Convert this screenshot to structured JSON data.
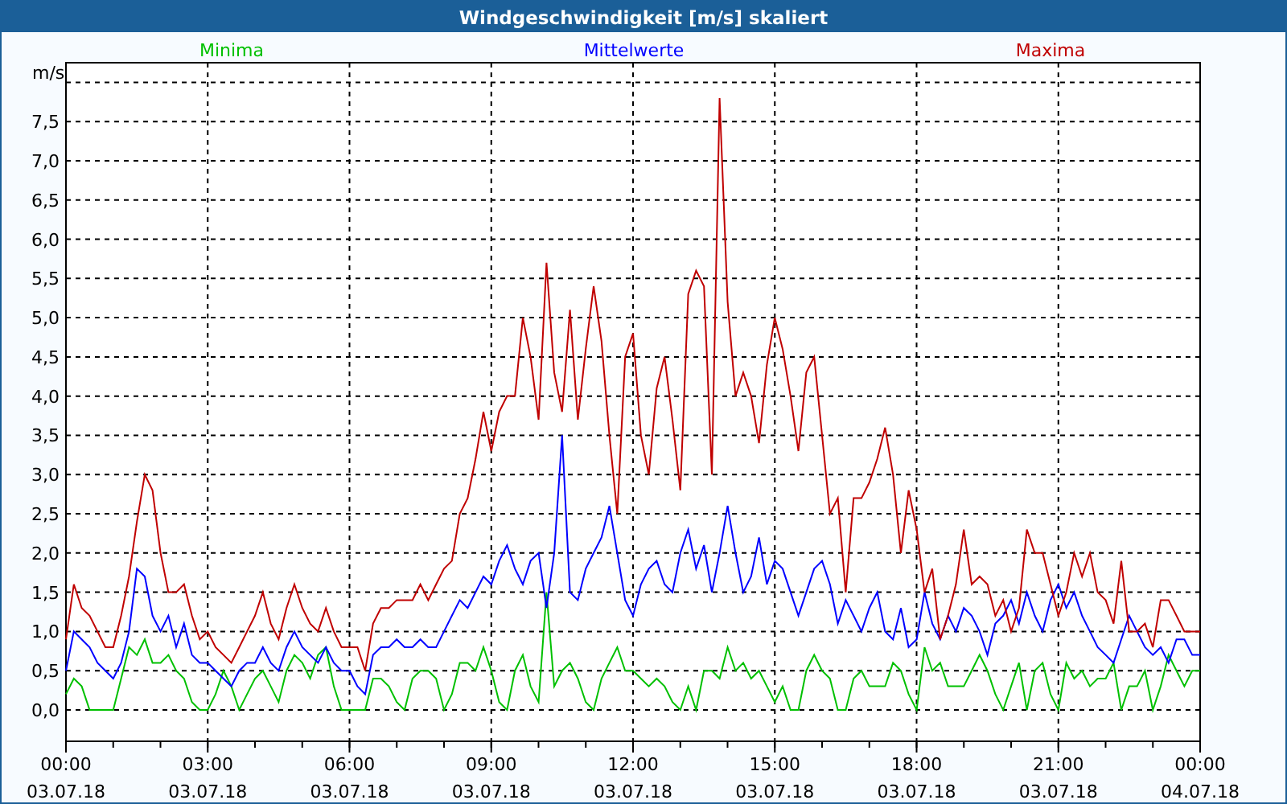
{
  "window": {
    "title": "Windgeschwindigkeit [m/s] skaliert"
  },
  "chart": {
    "x_tick_dates": [
      "03.07.18",
      "03.07.18",
      "03.07.18",
      "03.07.18",
      "03.07.18",
      "03.07.18",
      "03.07.18",
      "03.07.18",
      "04.07.18"
    ],
    "chart_data": {
      "type": "line",
      "ylabel": "m/s",
      "grid": true,
      "x": [
        0,
        0.167,
        0.333,
        0.5,
        0.667,
        0.833,
        1,
        1.167,
        1.333,
        1.5,
        1.667,
        1.833,
        2,
        2.167,
        2.333,
        2.5,
        2.667,
        2.833,
        3,
        3.167,
        3.333,
        3.5,
        3.667,
        3.833,
        4,
        4.167,
        4.333,
        4.5,
        4.667,
        4.833,
        5,
        5.167,
        5.333,
        5.5,
        5.667,
        5.833,
        6,
        6.167,
        6.333,
        6.5,
        6.667,
        6.833,
        7,
        7.167,
        7.333,
        7.5,
        7.667,
        7.833,
        8,
        8.167,
        8.333,
        8.5,
        8.667,
        8.833,
        9,
        9.167,
        9.333,
        9.5,
        9.667,
        9.833,
        10,
        10.167,
        10.333,
        10.5,
        10.667,
        10.833,
        11,
        11.167,
        11.333,
        11.5,
        11.667,
        11.833,
        12,
        12.167,
        12.333,
        12.5,
        12.667,
        12.833,
        13,
        13.167,
        13.333,
        13.5,
        13.667,
        13.833,
        14,
        14.167,
        14.333,
        14.5,
        14.667,
        14.833,
        15,
        15.167,
        15.333,
        15.5,
        15.667,
        15.833,
        16,
        16.167,
        16.333,
        16.5,
        16.667,
        16.833,
        17,
        17.167,
        17.333,
        17.5,
        17.667,
        17.833,
        18,
        18.167,
        18.333,
        18.5,
        18.667,
        18.833,
        19,
        19.167,
        19.333,
        19.5,
        19.667,
        19.833,
        20,
        20.167,
        20.333,
        20.5,
        20.667,
        20.833,
        21,
        21.167,
        21.333,
        21.5,
        21.667,
        21.833,
        22,
        22.167,
        22.333,
        22.5,
        22.667,
        22.833,
        23,
        23.167,
        23.333,
        23.5,
        23.667,
        23.833,
        24
      ],
      "xlim": [
        0,
        24
      ],
      "ylim": [
        -0.4,
        8.25
      ],
      "xticks": [
        {
          "value": 0,
          "label": "00:00"
        },
        {
          "value": 3,
          "label": "03:00"
        },
        {
          "value": 6,
          "label": "06:00"
        },
        {
          "value": 9,
          "label": "09:00"
        },
        {
          "value": 12,
          "label": "12:00"
        },
        {
          "value": 15,
          "label": "15:00"
        },
        {
          "value": 18,
          "label": "18:00"
        },
        {
          "value": 21,
          "label": "21:00"
        },
        {
          "value": 24,
          "label": "00:00"
        }
      ],
      "yticks": [
        {
          "value": 0,
          "label": "0,0"
        },
        {
          "value": 0.5,
          "label": "0,5"
        },
        {
          "value": 1,
          "label": "1,0"
        },
        {
          "value": 1.5,
          "label": "1,5"
        },
        {
          "value": 2,
          "label": "2,0"
        },
        {
          "value": 2.5,
          "label": "2,5"
        },
        {
          "value": 3,
          "label": "3,0"
        },
        {
          "value": 3.5,
          "label": "3,5"
        },
        {
          "value": 4,
          "label": "4,0"
        },
        {
          "value": 4.5,
          "label": "4,5"
        },
        {
          "value": 5,
          "label": "5,0"
        },
        {
          "value": 5.5,
          "label": "5,5"
        },
        {
          "value": 6,
          "label": "6,0"
        },
        {
          "value": 6.5,
          "label": "6,5"
        },
        {
          "value": 7,
          "label": "7,0"
        },
        {
          "value": 7.5,
          "label": "7,5"
        }
      ],
      "series": [
        {
          "name": "Minima",
          "color": "#00c000",
          "values": [
            0.2,
            0.4,
            0.3,
            0.0,
            0.0,
            0.0,
            0.0,
            0.4,
            0.8,
            0.7,
            0.9,
            0.6,
            0.6,
            0.7,
            0.5,
            0.4,
            0.1,
            0.0,
            0.0,
            0.2,
            0.5,
            0.3,
            0.0,
            0.2,
            0.4,
            0.5,
            0.3,
            0.1,
            0.5,
            0.7,
            0.6,
            0.4,
            0.7,
            0.8,
            0.3,
            0.0,
            0.0,
            0.0,
            0.0,
            0.4,
            0.4,
            0.3,
            0.1,
            0.0,
            0.4,
            0.5,
            0.5,
            0.4,
            0.0,
            0.2,
            0.6,
            0.6,
            0.5,
            0.8,
            0.5,
            0.1,
            0.0,
            0.5,
            0.7,
            0.3,
            0.1,
            1.5,
            0.3,
            0.5,
            0.6,
            0.4,
            0.1,
            0.0,
            0.4,
            0.6,
            0.8,
            0.5,
            0.5,
            0.4,
            0.3,
            0.4,
            0.3,
            0.1,
            0.0,
            0.3,
            0.0,
            0.5,
            0.5,
            0.4,
            0.8,
            0.5,
            0.6,
            0.4,
            0.5,
            0.3,
            0.1,
            0.3,
            0.0,
            0.0,
            0.5,
            0.7,
            0.5,
            0.4,
            0.0,
            0.0,
            0.4,
            0.5,
            0.3,
            0.3,
            0.3,
            0.6,
            0.5,
            0.2,
            0.0,
            0.8,
            0.5,
            0.6,
            0.3,
            0.3,
            0.3,
            0.5,
            0.7,
            0.5,
            0.2,
            0.0,
            0.3,
            0.6,
            0.0,
            0.5,
            0.6,
            0.2,
            0.0,
            0.6,
            0.4,
            0.5,
            0.3,
            0.4,
            0.4,
            0.6,
            0.0,
            0.3,
            0.3,
            0.5,
            0.0,
            0.3,
            0.7,
            0.5,
            0.3,
            0.5,
            0.5
          ]
        },
        {
          "name": "Mittelwerte",
          "color": "#0000ff",
          "values": [
            0.5,
            1.0,
            0.9,
            0.8,
            0.6,
            0.5,
            0.4,
            0.6,
            1.0,
            1.8,
            1.7,
            1.2,
            1.0,
            1.2,
            0.8,
            1.1,
            0.7,
            0.6,
            0.6,
            0.5,
            0.4,
            0.3,
            0.5,
            0.6,
            0.6,
            0.8,
            0.6,
            0.5,
            0.8,
            1.0,
            0.8,
            0.7,
            0.6,
            0.8,
            0.6,
            0.5,
            0.5,
            0.3,
            0.2,
            0.7,
            0.8,
            0.8,
            0.9,
            0.8,
            0.8,
            0.9,
            0.8,
            0.8,
            1.0,
            1.2,
            1.4,
            1.3,
            1.5,
            1.7,
            1.6,
            1.9,
            2.1,
            1.8,
            1.6,
            1.9,
            2.0,
            1.3,
            2.0,
            3.5,
            1.5,
            1.4,
            1.8,
            2.0,
            2.2,
            2.6,
            2.0,
            1.4,
            1.2,
            1.6,
            1.8,
            1.9,
            1.6,
            1.5,
            2.0,
            2.3,
            1.8,
            2.1,
            1.5,
            2.0,
            2.6,
            2.0,
            1.5,
            1.7,
            2.2,
            1.6,
            1.9,
            1.8,
            1.5,
            1.2,
            1.5,
            1.8,
            1.9,
            1.6,
            1.1,
            1.4,
            1.2,
            1.0,
            1.3,
            1.5,
            1.0,
            0.9,
            1.3,
            0.8,
            0.9,
            1.5,
            1.1,
            0.9,
            1.2,
            1.0,
            1.3,
            1.2,
            1.0,
            0.7,
            1.1,
            1.2,
            1.4,
            1.1,
            1.5,
            1.2,
            1.0,
            1.4,
            1.6,
            1.3,
            1.5,
            1.2,
            1.0,
            0.8,
            0.7,
            0.6,
            0.9,
            1.2,
            1.0,
            0.8,
            0.7,
            0.8,
            0.6,
            0.9,
            0.9,
            0.7,
            0.7
          ]
        },
        {
          "name": "Maxima",
          "color": "#c00000",
          "values": [
            0.9,
            1.6,
            1.3,
            1.2,
            1.0,
            0.8,
            0.8,
            1.2,
            1.7,
            2.4,
            3.0,
            2.8,
            2.0,
            1.5,
            1.5,
            1.6,
            1.2,
            0.9,
            1.0,
            0.8,
            0.7,
            0.6,
            0.8,
            1.0,
            1.2,
            1.5,
            1.1,
            0.9,
            1.3,
            1.6,
            1.3,
            1.1,
            1.0,
            1.3,
            1.0,
            0.8,
            0.8,
            0.8,
            0.5,
            1.1,
            1.3,
            1.3,
            1.4,
            1.4,
            1.4,
            1.6,
            1.4,
            1.6,
            1.8,
            1.9,
            2.5,
            2.7,
            3.2,
            3.8,
            3.3,
            3.8,
            4.0,
            4.0,
            5.0,
            4.5,
            3.7,
            5.7,
            4.3,
            3.8,
            5.1,
            3.7,
            4.6,
            5.4,
            4.7,
            3.5,
            2.5,
            4.5,
            4.8,
            3.5,
            3.0,
            4.1,
            4.5,
            3.7,
            2.8,
            5.3,
            5.6,
            5.4,
            3.0,
            7.8,
            5.2,
            4.0,
            4.3,
            4.0,
            3.4,
            4.4,
            5.0,
            4.6,
            4.0,
            3.3,
            4.3,
            4.5,
            3.5,
            2.5,
            2.7,
            1.5,
            2.7,
            2.7,
            2.9,
            3.2,
            3.6,
            3.0,
            2.0,
            2.8,
            2.3,
            1.5,
            1.8,
            0.9,
            1.2,
            1.6,
            2.3,
            1.6,
            1.7,
            1.6,
            1.2,
            1.4,
            1.0,
            1.3,
            2.3,
            2.0,
            2.0,
            1.6,
            1.2,
            1.5,
            2.0,
            1.7,
            2.0,
            1.5,
            1.4,
            1.1,
            1.9,
            1.0,
            1.0,
            1.1,
            0.8,
            1.4,
            1.4,
            1.2,
            1.0,
            1.0,
            1.0
          ]
        }
      ]
    }
  }
}
